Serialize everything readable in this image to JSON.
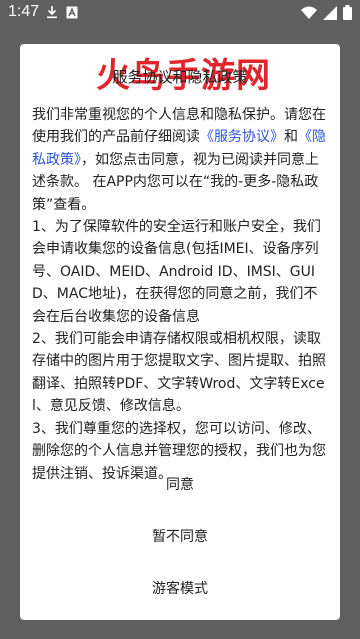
{
  "status_bar": {
    "time": "1:47",
    "left_icons": [
      "download-icon",
      "text-a-icon"
    ],
    "right_icons": [
      "wifi-icon",
      "signal-icon",
      "battery-icon"
    ]
  },
  "dialog": {
    "watermark": "火鸟手游网",
    "title": "服务协议和隐私政策",
    "intro_text_1": "我们非常重视您的个人信息和隐私保护。请您在使用我们的产品前仔细阅读",
    "service_link": "《服务协议》",
    "and_text": "和",
    "privacy_link": "《隐私政策》",
    "intro_text_2": "，如您点击同意，视为已阅读并同意上述条款。 在APP内您可以在“我的-更多-隐私政策”查看。",
    "paragraph_1": "1、为了保障软件的安全运行和账户安全，我们会申请收集您的设备信息(包括IMEI、设备序列号、OAID、MEID、Android ID、IMSI、GUID、MAC地址)，在获得您的同意之前，我们不会在后台收集您的设备信息",
    "paragraph_2": "2、我们可能会申请存储权限或相机权限，读取存储中的图片用于您提取文字、图片提取、拍照翻译、拍照转PDF、文字转Wrod、文字转Excel、意见反馈、修改信息。",
    "paragraph_3": "3、我们尊重您的选择权，您可以访问、修改、删除您的个人信息并管理您的授权，我们也为您提供注销、投诉渠道。",
    "agree_label": "同意",
    "disagree_label": "暂不同意",
    "guest_label": "游客模式"
  },
  "colors": {
    "backdrop": "#5f5f5f",
    "dialog_bg": "#ffffff",
    "link": "#2f54d8",
    "watermark": "#e2252b",
    "text": "#222222"
  }
}
